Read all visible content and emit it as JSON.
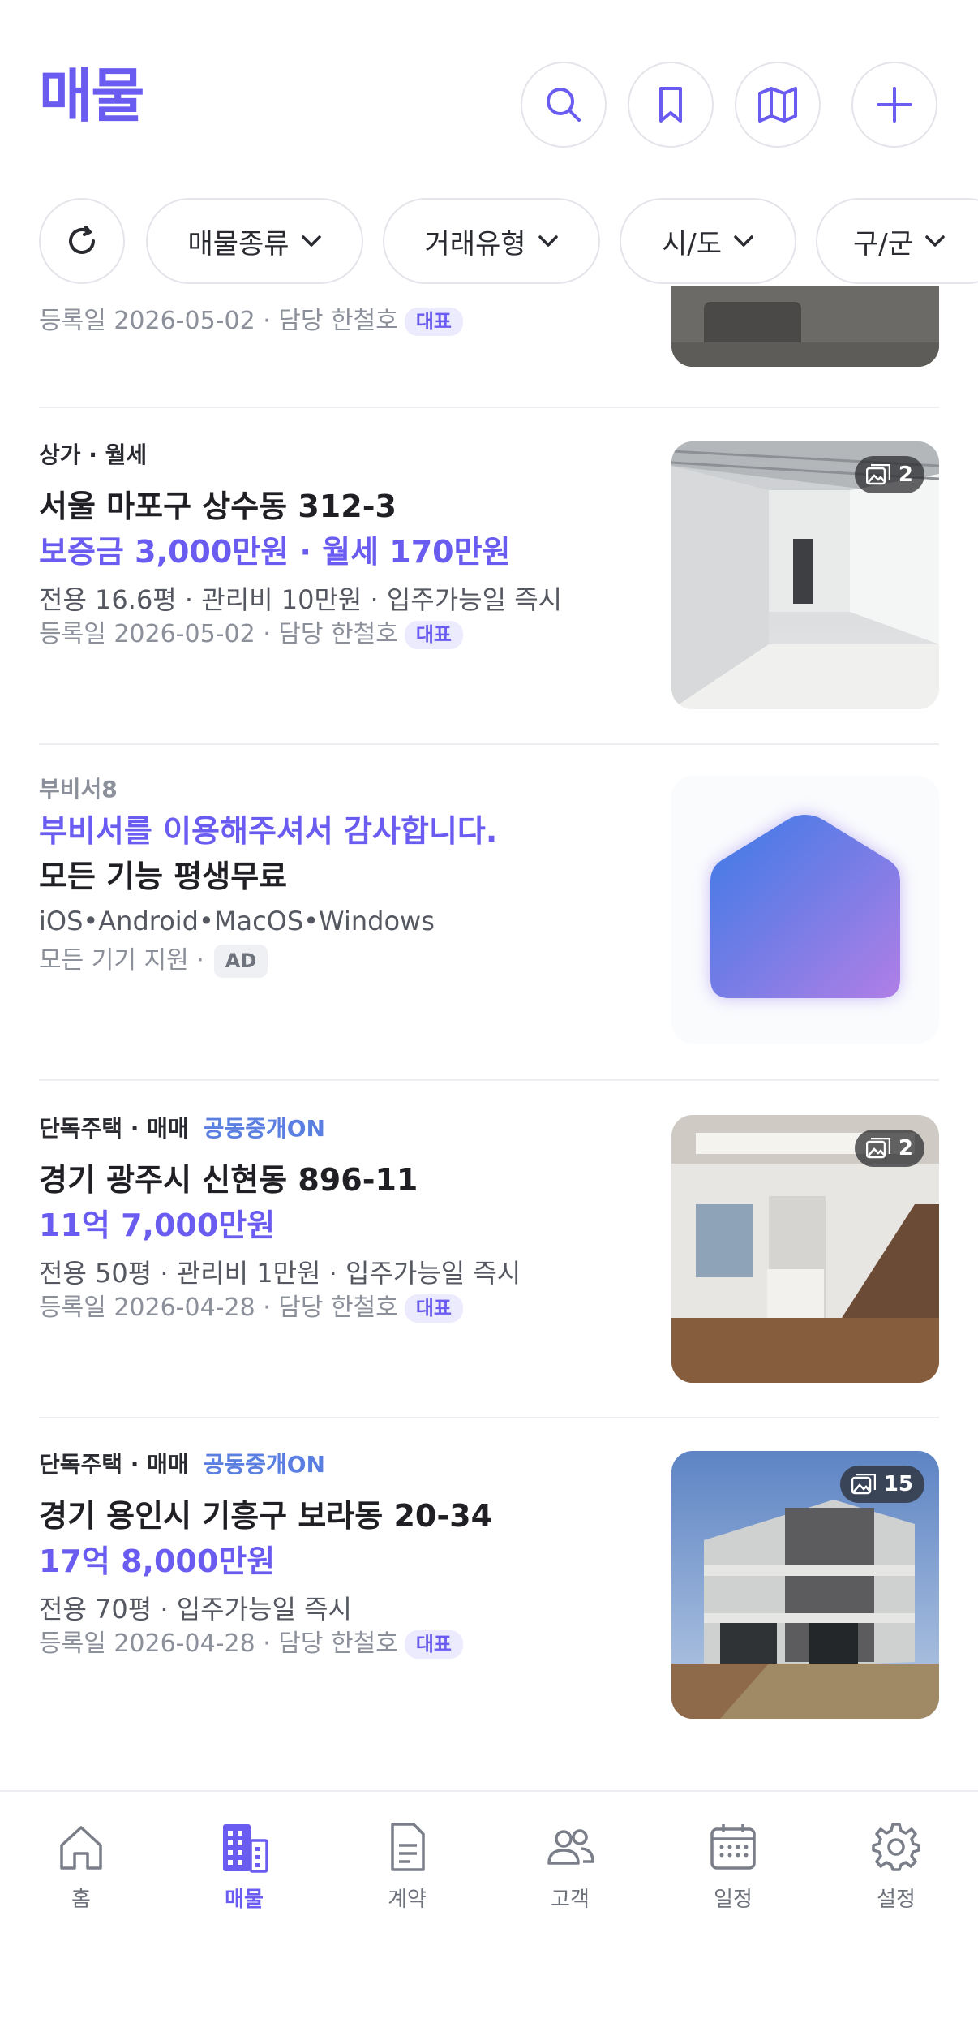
{
  "header": {
    "title": "매물"
  },
  "header_buttons": {
    "search": "search-icon",
    "bookmark": "bookmark-icon",
    "map": "map-icon",
    "add": "plus-icon"
  },
  "filters": {
    "refresh_icon": "refresh-icon",
    "chips": [
      "매물종류",
      "거래유형",
      "시/도",
      "구/군"
    ]
  },
  "listings": [
    {
      "registered": "등록일 2026-05-02 · 담당 한철호",
      "badge": "대표"
    },
    {
      "category": "상가 · 월세",
      "address": "서울 마포구 상수동 312-3",
      "price": "보증금 3,000만원 · 월세 170만원",
      "details": "전용 16.6평 · 관리비 10만원 · 입주가능일 즉시",
      "registered": "등록일 2026-05-02 · 담당 한철호",
      "badge": "대표",
      "photo_count": "2"
    },
    {
      "category": "단독주택 · 매매",
      "cooperative": "공동중개ON",
      "address": "경기 광주시 신현동 896-11",
      "price": "11억 7,000만원",
      "details": "전용 50평 · 관리비 1만원 · 입주가능일 즉시",
      "registered": "등록일 2026-04-28 · 담당 한철호",
      "badge": "대표",
      "photo_count": "2"
    },
    {
      "category": "단독주택 · 매매",
      "cooperative": "공동중개ON",
      "address": "경기 용인시 기흥구 보라동 20-34",
      "price": "17억 8,000만원",
      "details": "전용 70평 · 입주가능일 즉시",
      "registered": "등록일 2026-04-28 · 담당 한철호",
      "badge": "대표",
      "photo_count": "15"
    }
  ],
  "ad": {
    "sponsor": "부비서8",
    "headline": "부비서를 이용해주셔서 감사합니다.",
    "subline": "모든 기능 평생무료",
    "platforms": "iOS•Android•MacOS•Windows",
    "support": "모든 기기 지원 ·",
    "badge": "AD"
  },
  "tabs": [
    {
      "label": "홈",
      "icon": "home-icon"
    },
    {
      "label": "매물",
      "icon": "building-icon",
      "active": true
    },
    {
      "label": "계약",
      "icon": "document-icon"
    },
    {
      "label": "고객",
      "icon": "users-icon"
    },
    {
      "label": "일정",
      "icon": "calendar-icon"
    },
    {
      "label": "설정",
      "icon": "gear-icon"
    }
  ],
  "colors": {
    "accent": "#6a5cf0",
    "coop": "#5b7fe0"
  }
}
